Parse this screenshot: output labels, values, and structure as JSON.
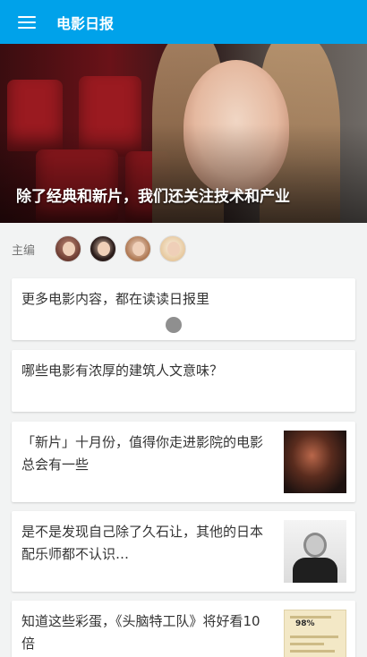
{
  "header": {
    "title": "电影日报",
    "menu_icon": "hamburger-menu-icon",
    "background_color": "#00a2ea"
  },
  "hero": {
    "title": "除了经典和新片，我们还关注技术和产业"
  },
  "editors": {
    "label": "主编",
    "avatars": [
      "editor-1",
      "editor-2",
      "editor-3",
      "editor-4"
    ]
  },
  "stories": [
    {
      "title": "更多电影内容，都在读读日报里"
    },
    {
      "title": "哪些电影有浓厚的建筑人文意味？"
    },
    {
      "title": "「新片」十月份，值得你走进影院的电影总会有一些"
    },
    {
      "title": "是不是发现自己除了久石让，其他的日本配乐师都不认识…"
    },
    {
      "title": "知道这些彩蛋，《头脑特工队》将好看10倍"
    }
  ],
  "story_5_thumb_text": "98%"
}
